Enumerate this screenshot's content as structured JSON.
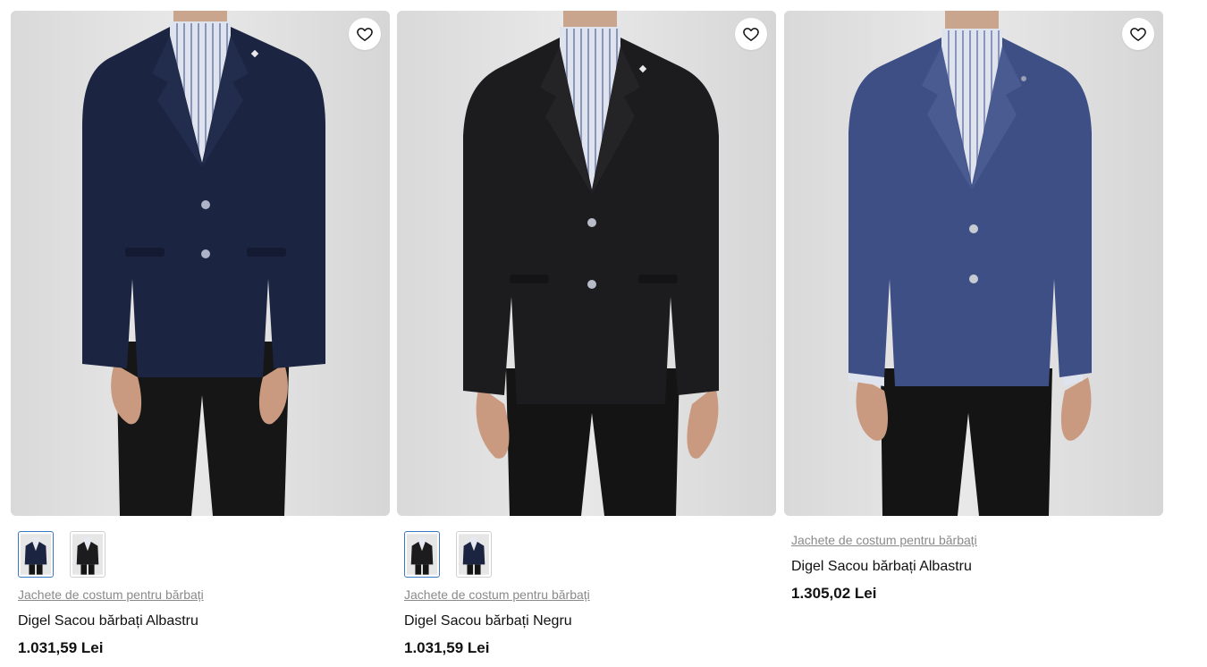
{
  "colors": {
    "background": "#ffffff",
    "category_text": "#8a8a8a",
    "active_swatch_border": "#3a78c2",
    "navy_jacket": "#1b2440",
    "black_jacket": "#1c1b1d",
    "blue_jacket": "#3e4f85"
  },
  "products": [
    {
      "category": "Jachete de costum pentru bărbați",
      "name": "Digel Sacou bărbați Albastru",
      "price": "1.031,59 Lei",
      "favorite_icon": "heart-icon",
      "swatches": [
        {
          "color": "navy",
          "active": true
        },
        {
          "color": "black",
          "active": false
        }
      ]
    },
    {
      "category": "Jachete de costum pentru bărbați",
      "name": "Digel Sacou bărbați Negru",
      "price": "1.031,59 Lei",
      "favorite_icon": "heart-icon",
      "swatches": [
        {
          "color": "black",
          "active": true
        },
        {
          "color": "navy",
          "active": false
        }
      ]
    },
    {
      "category": "Jachete de costum pentru bărbați",
      "name": "Digel Sacou bărbați Albastru",
      "price": "1.305,02 Lei",
      "favorite_icon": "heart-icon",
      "swatches": []
    }
  ]
}
